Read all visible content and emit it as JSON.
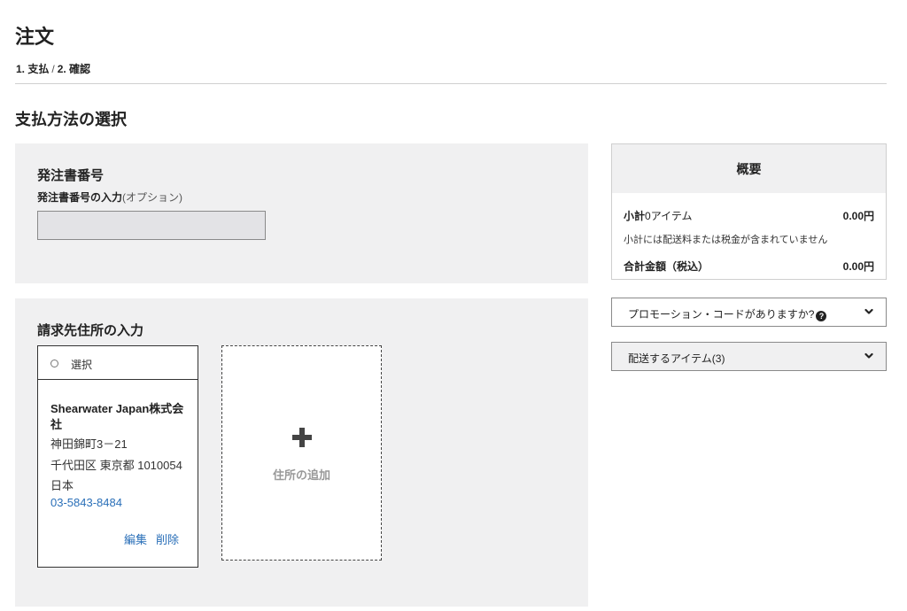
{
  "header": {
    "title": "注文",
    "breadcrumb": {
      "step1": "1. 支払",
      "separator": "/",
      "step2": "2. 確認"
    }
  },
  "section_title": "支払方法の選択",
  "po_section": {
    "title": "発注書番号",
    "field_label": "発注書番号の入力",
    "field_label_optional": "(オプション)",
    "value": ""
  },
  "billing": {
    "title": "請求先住所の入力",
    "address_card": {
      "select_label": "選択",
      "company": "Shearwater Japan株式会社",
      "line1": "神田錦町3－21",
      "line2": "千代田区 東京都 1010054",
      "country": "日本",
      "phone": "03-5843-8484",
      "edit_label": "編集",
      "delete_label": "削除"
    },
    "add_address_label": "住所の追加"
  },
  "summary": {
    "title": "概要",
    "subtotal_label": "小計",
    "subtotal_items": "0アイテム",
    "subtotal_value": "0.00円",
    "subtotal_note": "小計には配送料または税金が含まれていません",
    "total_label": "合計金額（税込）",
    "total_value": "0.00円"
  },
  "promo": {
    "label": "プロモーション・コードがありますか?",
    "help_glyph": "?"
  },
  "items_to_ship": {
    "label": "配送するアイテム(3)"
  },
  "colors": {
    "panel_bg": "#f0f0f1",
    "link": "#2a6fb8",
    "border": "#8a8a8a"
  }
}
